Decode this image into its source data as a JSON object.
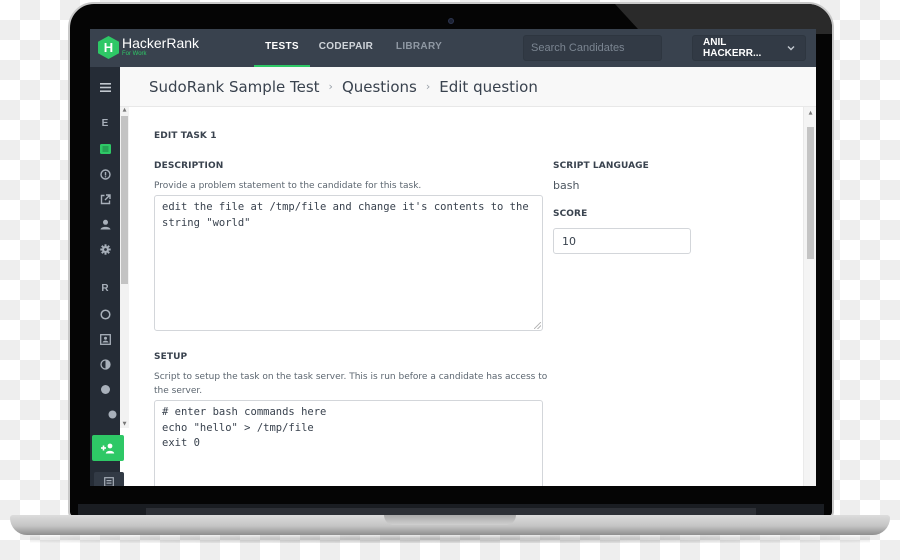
{
  "app": {
    "brand": "HackerRank",
    "brand_sub": "For Work",
    "logo_letter": "H",
    "accent_color": "#2ec866",
    "nav_bg_color": "#39424e"
  },
  "topnav": {
    "tabs": [
      {
        "label": "TESTS",
        "active": true
      },
      {
        "label": "CODEPAIR",
        "active": false
      },
      {
        "label": "LIBRARY",
        "active": false
      }
    ],
    "search_placeholder": "Search Candidates",
    "user_label": "ANIL HACKERR...",
    "user_chevron": "⌄"
  },
  "sidenav": {
    "menu_icon": "hamburger-icon",
    "items": [
      {
        "label": "E",
        "icon": "letter-e"
      },
      {
        "label": "",
        "icon": "document-list-icon",
        "active": true
      },
      {
        "label": "",
        "icon": "info-circle-icon"
      },
      {
        "label": "",
        "icon": "external-link-icon"
      },
      {
        "label": "",
        "icon": "user-icon"
      },
      {
        "label": "",
        "icon": "gear-icon"
      },
      {
        "label": "R",
        "icon": "letter-r"
      },
      {
        "label": "",
        "icon": "circle-outline-icon"
      },
      {
        "label": "",
        "icon": "image-icon"
      },
      {
        "label": "",
        "icon": "half-circle-icon"
      },
      {
        "label": "",
        "icon": "filled-circle-icon"
      }
    ],
    "add_button_icon": "add-user-icon",
    "bottom_icon": "window-icon"
  },
  "breadcrumb": {
    "items": [
      "SudoRank Sample Test",
      "Questions",
      "Edit question"
    ],
    "separator": "›"
  },
  "form": {
    "title": "EDIT TASK 1",
    "description": {
      "label": "DESCRIPTION",
      "hint": "Provide a problem statement to the candidate for this task.",
      "value": "edit the file at /tmp/file and change it's contents to the string \"world\""
    },
    "setup": {
      "label": "SETUP",
      "hint": "Script to setup the task on the task server. This is run before a candidate has access to the server.",
      "value": "# enter bash commands here\necho \"hello\" > /tmp/file\nexit 0"
    },
    "script_language": {
      "label": "SCRIPT LANGUAGE",
      "value": "bash"
    },
    "score": {
      "label": "SCORE",
      "value": "10"
    }
  }
}
